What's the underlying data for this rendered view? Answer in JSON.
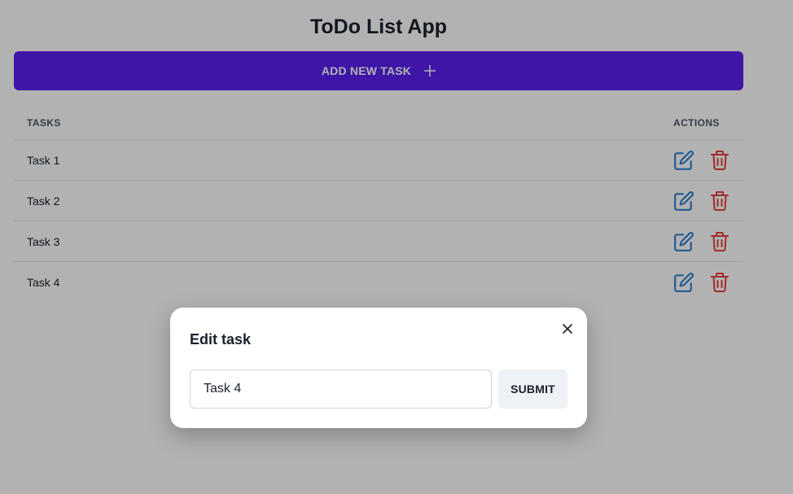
{
  "app": {
    "title": "ToDo List App"
  },
  "add_task": {
    "label": "ADD NEW TASK",
    "icon": "plus-icon",
    "color": "#5a1ff0"
  },
  "table": {
    "headers": {
      "tasks": "TASKS",
      "actions": "ACTIONS"
    },
    "rows": [
      {
        "task": "Task 1"
      },
      {
        "task": "Task 2"
      },
      {
        "task": "Task 3"
      },
      {
        "task": "Task 4"
      }
    ],
    "edit_icon": "edit-icon",
    "delete_icon": "trash-icon",
    "edit_color": "#3182ce",
    "delete_color": "#e53e3e"
  },
  "modal": {
    "title": "Edit task",
    "input_value": "Task 4",
    "submit_label": "SUBMIT",
    "close_icon": "close-icon"
  }
}
